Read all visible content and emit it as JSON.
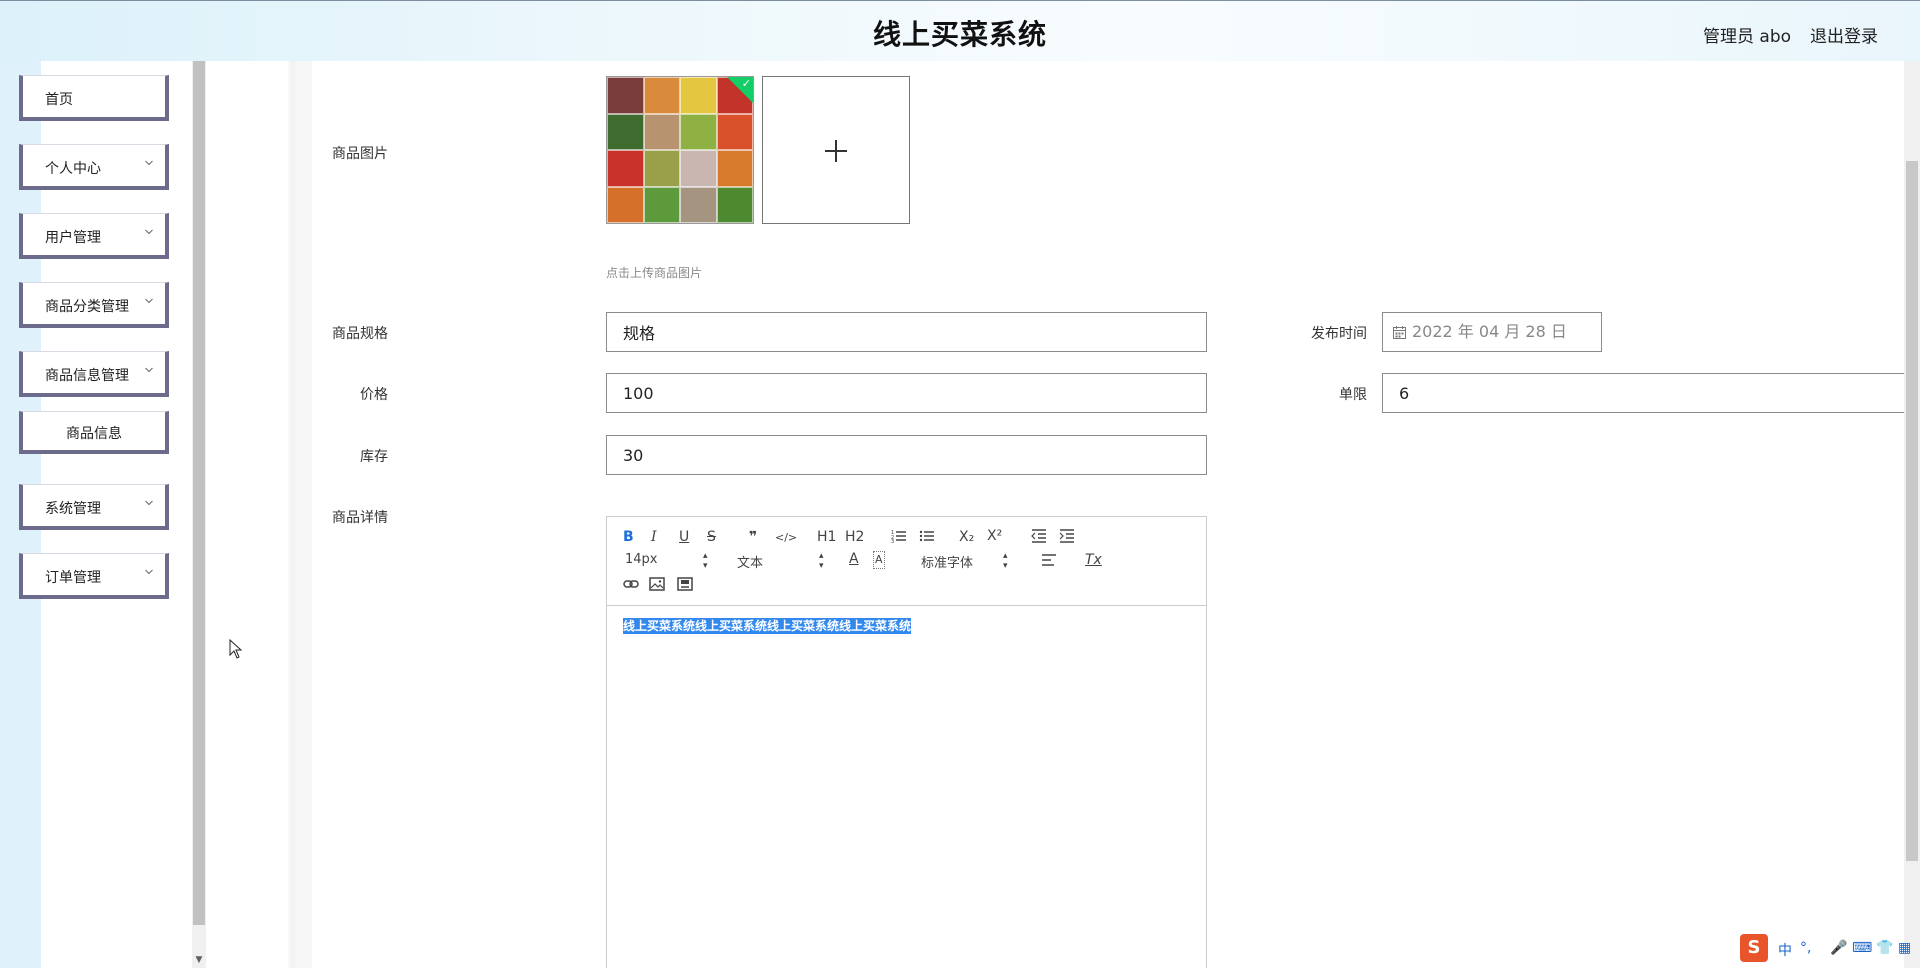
{
  "header": {
    "title": "线上买菜系统",
    "user": "管理员 abo",
    "logout": "退出登录"
  },
  "sidebar": {
    "items": [
      {
        "label": "首页",
        "has_arrow": false
      },
      {
        "label": "个人中心",
        "has_arrow": true
      },
      {
        "label": "用户管理",
        "has_arrow": true
      },
      {
        "label": "商品分类管理",
        "has_arrow": true
      },
      {
        "label": "商品信息管理",
        "has_arrow": true
      },
      {
        "label": "商品信息",
        "has_arrow": false,
        "sub": true
      },
      {
        "label": "系统管理",
        "has_arrow": true
      },
      {
        "label": "订单管理",
        "has_arrow": true
      }
    ]
  },
  "form": {
    "image_label": "商品图片",
    "image_hint": "点击上传商品图片",
    "spec_label": "商品规格",
    "spec_value": "规格",
    "publish_label": "发布时间",
    "publish_value": "2022 年 04 月 28 日",
    "price_label": "价格",
    "price_value": "100",
    "limit_label": "单限",
    "limit_value": "6",
    "stock_label": "库存",
    "stock_value": "30",
    "detail_label": "商品详情"
  },
  "editor": {
    "toolbar": {
      "bold": "B",
      "italic": "I",
      "underline": "U",
      "strike": "S",
      "quote": "❞",
      "code": "</>",
      "h1": "H1",
      "h2": "H2",
      "ordered_list": "ordered-list-icon",
      "bullet_list": "bullet-list-icon",
      "subscript": "X₂",
      "superscript": "X²",
      "outdent": "outdent-icon",
      "indent": "indent-icon",
      "size_select": "14px",
      "header_select": "文本",
      "font_select": "标准字体",
      "color": "A",
      "background": "A",
      "align": "align-icon",
      "clean": "Tx",
      "link": "link-icon",
      "image": "image-icon",
      "video": "video-icon"
    },
    "content": "线上买菜系统线上买菜系统线上买菜系统线上买菜系统"
  },
  "ime": {
    "logo": "S",
    "lang": "中",
    "punct": "°,"
  }
}
